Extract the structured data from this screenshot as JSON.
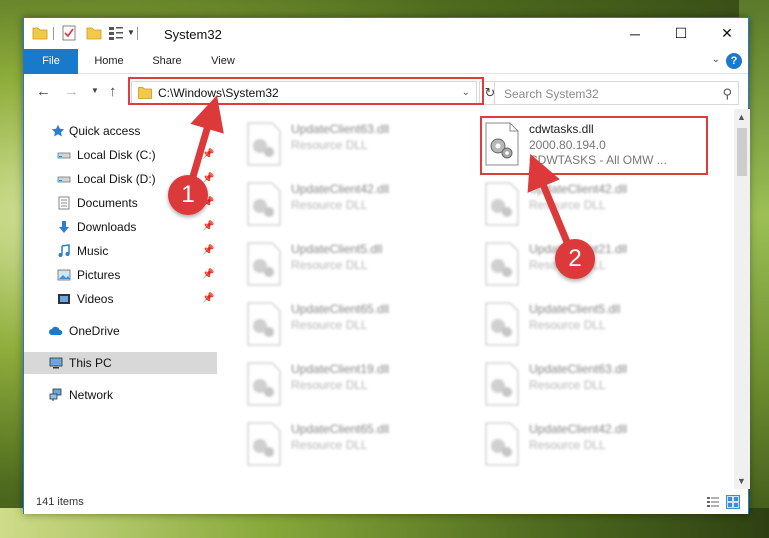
{
  "window": {
    "title": "System32",
    "colors": {
      "accent": "#1979ca",
      "highlight": "#e03c3c"
    }
  },
  "titlebar": {
    "minimize_glyph": "─",
    "maximize_glyph": "☐",
    "close_glyph": "✕"
  },
  "ribbon": {
    "tabs": [
      {
        "label": "File"
      },
      {
        "label": "Home"
      },
      {
        "label": "Share"
      },
      {
        "label": "View"
      }
    ],
    "help_glyph": "?"
  },
  "navbar": {
    "address": "C:\\Windows\\System32",
    "search_placeholder": "Search System32"
  },
  "sidebar": {
    "items": [
      {
        "label": "Quick access",
        "icon": "star-icon"
      },
      {
        "label": "Local Disk (C:)",
        "icon": "drive-icon",
        "pinned": true
      },
      {
        "label": "Local Disk (D:)",
        "icon": "drive-icon",
        "pinned": true
      },
      {
        "label": "Documents",
        "icon": "documents-icon",
        "pinned": true
      },
      {
        "label": "Downloads",
        "icon": "downloads-icon",
        "pinned": true
      },
      {
        "label": "Music",
        "icon": "music-icon",
        "pinned": true
      },
      {
        "label": "Pictures",
        "icon": "pictures-icon",
        "pinned": true
      },
      {
        "label": "Videos",
        "icon": "videos-icon",
        "pinned": true
      },
      {
        "label": "OneDrive",
        "icon": "cloud-icon"
      },
      {
        "label": "This PC",
        "icon": "computer-icon",
        "selected": true
      },
      {
        "label": "Network",
        "icon": "network-icon"
      }
    ]
  },
  "files": {
    "left_column": [
      {
        "name": "UpdateClient63.dll",
        "type": "Resource DLL"
      },
      {
        "name": "UpdateClient42.dll",
        "type": "Resource DLL"
      },
      {
        "name": "UpdateClient5.dll",
        "type": "Resource DLL"
      },
      {
        "name": "UpdateClient65.dll",
        "type": "Resource DLL"
      },
      {
        "name": "UpdateClient19.dll",
        "type": "Resource DLL"
      },
      {
        "name": "UpdateClient65.dll",
        "type": "Resource DLL"
      }
    ],
    "highlighted": {
      "name": "cdwtasks.dll",
      "version": "2000.80.194.0",
      "description": "CDWTASKS - All OMW ..."
    },
    "right_column": [
      {
        "name": "UpdateClient42.dll",
        "type": "Resource DLL"
      },
      {
        "name": "UpdateClient21.dll",
        "type": "Resource DLL"
      },
      {
        "name": "UpdateClient5.dll",
        "type": "Resource DLL"
      },
      {
        "name": "UpdateClient63.dll",
        "type": "Resource DLL"
      },
      {
        "name": "UpdateClient42.dll",
        "type": "Resource DLL"
      }
    ]
  },
  "status": {
    "item_count": "141 items"
  },
  "callouts": [
    {
      "number": "1"
    },
    {
      "number": "2"
    }
  ]
}
